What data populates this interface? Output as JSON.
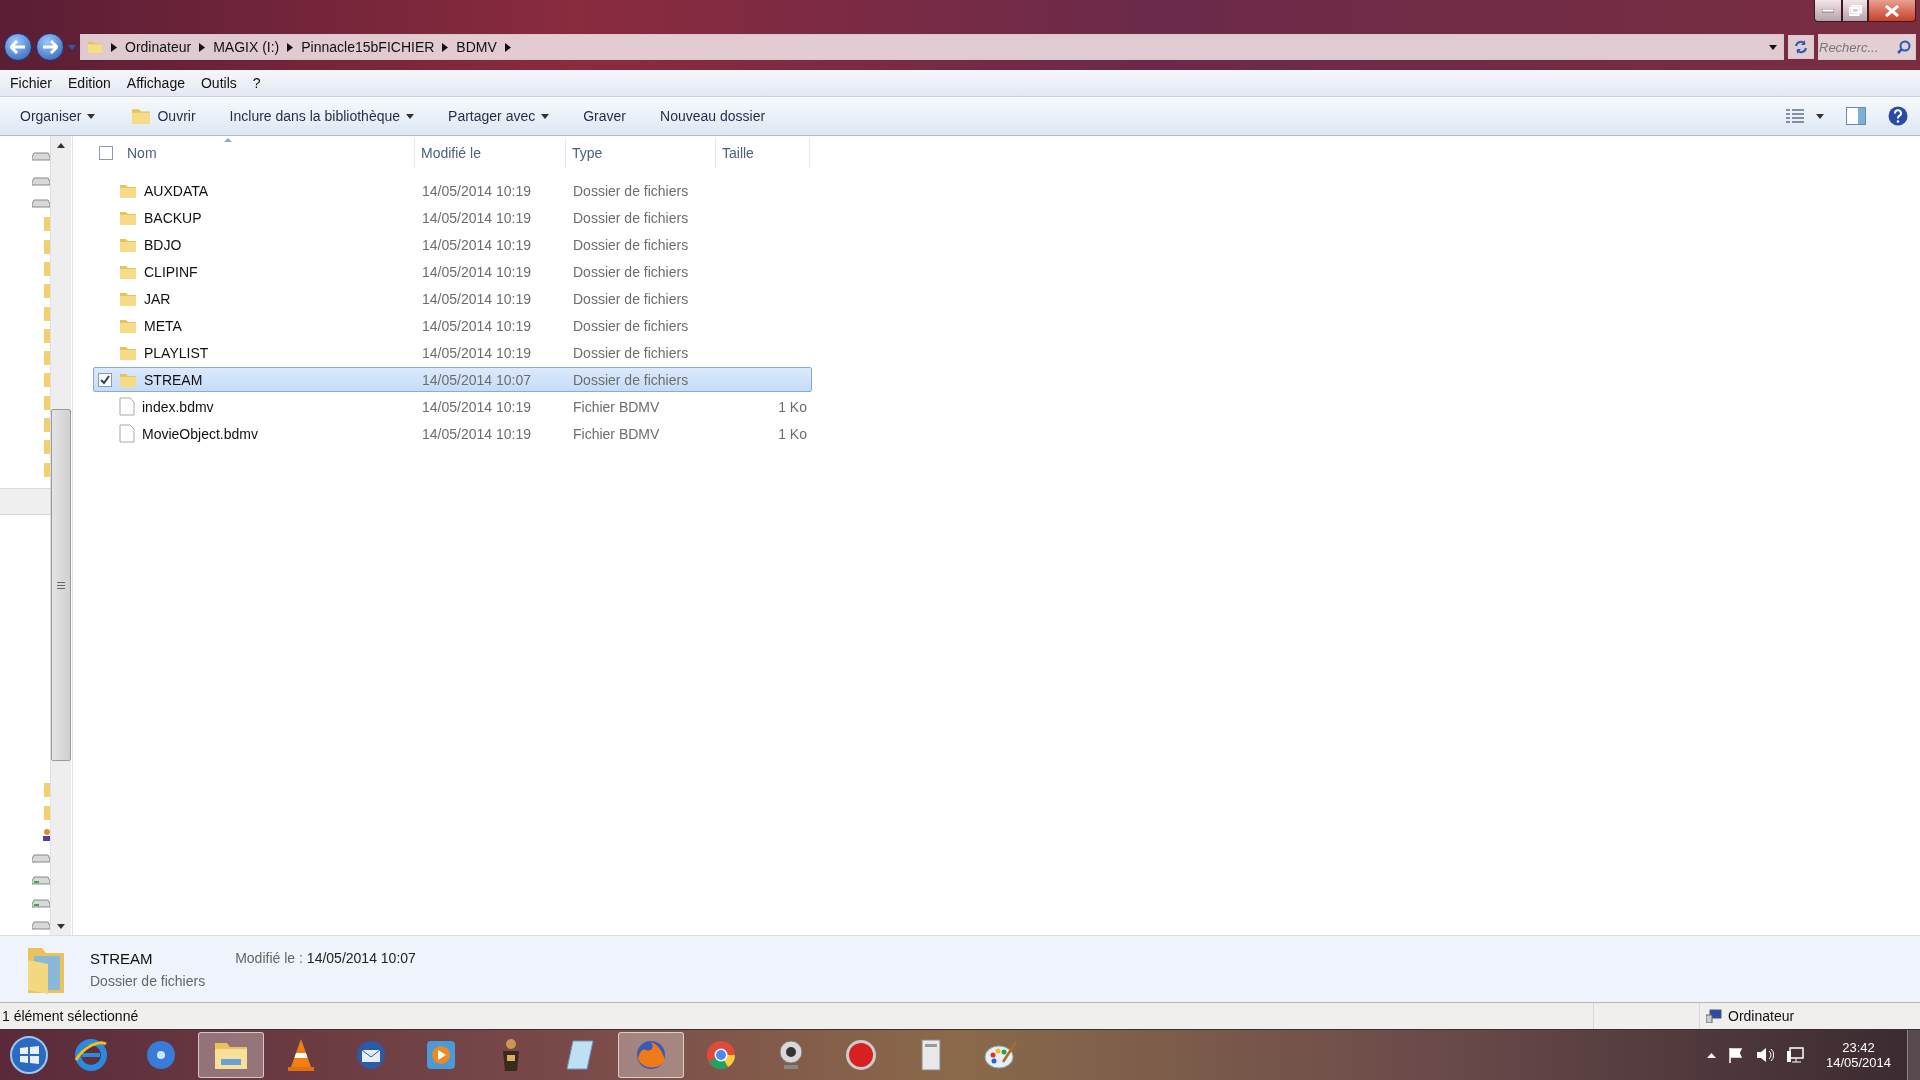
{
  "address_bar": {
    "crumbs": [
      "Ordinateur",
      "MAGIX (I:)",
      "Pinnacle15bFICHIER",
      "BDMV"
    ]
  },
  "search": {
    "placeholder": "Recherc..."
  },
  "menu_bar": [
    "Fichier",
    "Edition",
    "Affichage",
    "Outils",
    "?"
  ],
  "toolbar": [
    {
      "label": "Organiser",
      "kind": "menu"
    },
    {
      "label": "Ouvrir",
      "kind": "icon"
    },
    {
      "label": "Inclure dans la bibliothèque",
      "kind": "menu"
    },
    {
      "label": "Partager avec",
      "kind": "menu"
    },
    {
      "label": "Graver",
      "kind": "plain"
    },
    {
      "label": "Nouveau dossier",
      "kind": "plain"
    }
  ],
  "table": {
    "header_checkbox": {
      "checked": false
    },
    "columns": [
      "Nom",
      "Modifié le",
      "Type",
      "Taille"
    ],
    "rows": [
      {
        "name": "AUXDATA",
        "modified": "14/05/2014 10:19",
        "type": "Dossier de fichiers",
        "kind": "folder",
        "selected": false
      },
      {
        "name": "BACKUP",
        "modified": "14/05/2014 10:19",
        "type": "Dossier de fichiers",
        "kind": "folder",
        "selected": false
      },
      {
        "name": "BDJO",
        "modified": "14/05/2014 10:19",
        "type": "Dossier de fichiers",
        "kind": "folder",
        "selected": false
      },
      {
        "name": "CLIPINF",
        "modified": "14/05/2014 10:19",
        "type": "Dossier de fichiers",
        "kind": "folder",
        "selected": false
      },
      {
        "name": "JAR",
        "modified": "14/05/2014 10:19",
        "type": "Dossier de fichiers",
        "kind": "folder",
        "selected": false
      },
      {
        "name": "META",
        "modified": "14/05/2014 10:19",
        "type": "Dossier de fichiers",
        "kind": "folder",
        "selected": false
      },
      {
        "name": "PLAYLIST",
        "modified": "14/05/2014 10:19",
        "type": "Dossier de fichiers",
        "kind": "folder",
        "selected": false
      },
      {
        "name": "STREAM",
        "modified": "14/05/2014 10:07",
        "type": "Dossier de fichiers",
        "kind": "folder",
        "selected": true
      },
      {
        "name": "index.bdmv",
        "modified": "14/05/2014 10:19",
        "type": "Fichier BDMV",
        "size": "1 Ko",
        "kind": "file",
        "selected": false
      },
      {
        "name": "MovieObject.bdmv",
        "modified": "14/05/2014 10:19",
        "type": "Fichier BDMV",
        "size": "1 Ko",
        "kind": "file",
        "selected": false
      }
    ]
  },
  "details_pane": {
    "name": "STREAM",
    "type": "Dossier de fichiers",
    "modified_label": "Modifié le :",
    "modified": "14/05/2014 10:07"
  },
  "status_bar": {
    "selection": "1 élément sélectionné",
    "location": "Ordinateur"
  },
  "taskbar": {
    "items": [
      {
        "kind": "browser-e",
        "active": false
      },
      {
        "kind": "disc",
        "active": false
      },
      {
        "kind": "folder",
        "active": true
      },
      {
        "kind": "cone",
        "active": false
      },
      {
        "kind": "mail",
        "active": false
      },
      {
        "kind": "play",
        "active": false
      },
      {
        "kind": "figure",
        "active": false
      },
      {
        "kind": "notepad",
        "active": false
      },
      {
        "kind": "fox",
        "active": true
      },
      {
        "kind": "wheel",
        "active": false
      },
      {
        "kind": "webcam",
        "active": false
      },
      {
        "kind": "red-disc",
        "active": false
      },
      {
        "kind": "tower",
        "active": false
      },
      {
        "kind": "palette",
        "active": false
      }
    ],
    "time": "23:42",
    "date": "14/05/2014"
  }
}
